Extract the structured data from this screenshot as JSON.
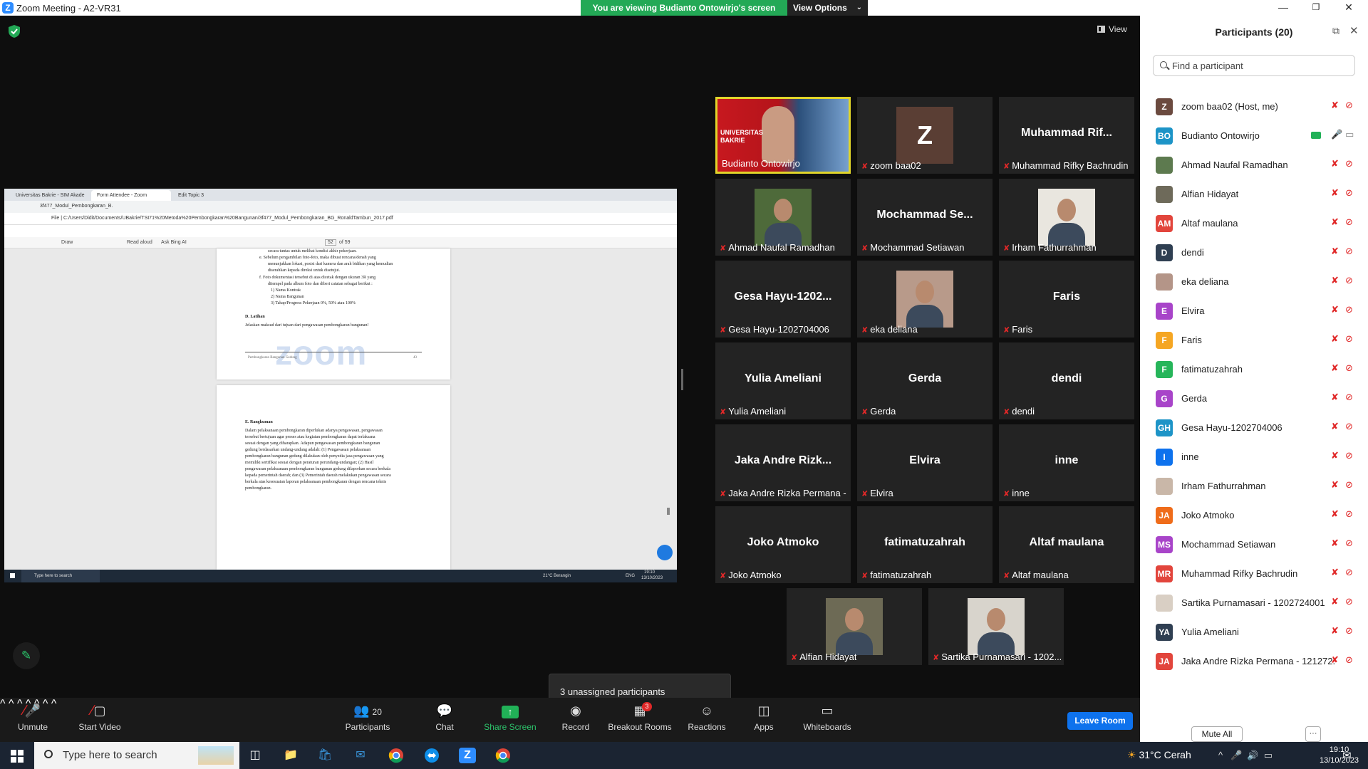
{
  "window": {
    "title": "Zoom Meeting - A2-VR31"
  },
  "banner": {
    "viewing": "You are viewing Budianto Ontowirjo's screen",
    "view_options": "View Options"
  },
  "main": {
    "view_label": "View"
  },
  "shared_screen": {
    "tabs": [
      "Universitas Bakrie - SIM Akade",
      "Form Attendee - Zoom",
      "Edit Topic 3"
    ],
    "file_tab": "3f477_Modul_Pembongkaran_B.",
    "address": "File | C:/Users/Didit/Documents/UBakrie/TSI71%20Metoda%20Pembongkaran%20Bangunan/3f477_Modul_Pembongkaran_BG_RonaldTambun_2017.pdf",
    "pdf_tools": [
      "Draw",
      "Read aloud",
      "Ask Bing AI"
    ],
    "page_num": "52",
    "page_total": "of 59",
    "page1_lines": [
      "secara tuntas untuk melihat kondisi akhir pekerjaan.",
      "e.   Sebelum pengambilan foto-foto, maka dibuat rencana/denah yang",
      "menunjukkan lokasi, posisi dari kamera dan arah bidikan yang kemudian",
      "diserahkan kepada direksi untuk disetujui.",
      "f.   Foto dokumentasi tersebut di atas dicetak dengan ukuran 3R yang",
      "ditempel pada album foto dan diberi catatan sebagai berikut :",
      "1)   Nama Kontrak",
      "2)   Nama Bangunan",
      "3)   Tahap/Progress Pekerjaan 0%, 50% atau 100%"
    ],
    "latihan_title": "D.   Latihan",
    "latihan_text": "Jelaskan maksud dari tujuan dari pengawasan pembongkaran bangunan!",
    "watermark": "zoom",
    "footer_left": "Pembongkaran Bangunan Gedung",
    "footer_page": "43",
    "rangkuman_title": "E.     Rangkuman",
    "rangkuman_lines": [
      "Dalam pelaksanaan pembongkaran diperlukan adanya pengawasan, pengawasan",
      "tersebut bertujuan agar proses atau kegiatan pembongkaran dapat terlaksana",
      "sesuai dengan yang diharapkan. Adapun pengawasan pembongkaran bangunan",
      "gedung berdasarkan undang-undang adalah: (1) Pengawasan pelaksanaan",
      "pembongkaran bangunan gedung dilakukan oleh penyedia jasa pengawasan yang",
      "memiliki sertifikat sesuai dengan peraturan perundang-undangan; (2) Hasil",
      "pengawasan pelaksanaan pembongkaran bangunan gedung dilaporkan secara berkala",
      "kepada pemerintah daerah; dan (3) Pemerintah daerah melakukan pengawasan secara",
      "berkala atas kesesuaian laporan pelaksanaan pembongkaran dengan rencana teknis",
      "pembongkaran."
    ],
    "taskbar": {
      "search": "Type here to search",
      "weather": "21°C Berangin",
      "lang": "ENG",
      "time": "19:10",
      "date": "13/10/2023"
    }
  },
  "tiles": [
    {
      "label": "Budianto Ontowirjo",
      "center": "",
      "type": "video"
    },
    {
      "label": "zoom baa02",
      "center": "",
      "type": "avatar-z"
    },
    {
      "label": "Muhammad Rifky Bachrudin",
      "center": "Muhammad  Rif..."
    },
    {
      "label": "Ahmad Naufal Ramadhan",
      "center": "",
      "type": "photo"
    },
    {
      "label": "Mochammad Setiawan",
      "center": "Mochammad  Se..."
    },
    {
      "label": "Irham Fathurrahman",
      "center": "",
      "type": "photo"
    },
    {
      "label": "Gesa Hayu-1202704006",
      "center": "Gesa  Hayu-1202..."
    },
    {
      "label": "eka deliana",
      "center": "",
      "type": "photo"
    },
    {
      "label": "Faris",
      "center": "Faris"
    },
    {
      "label": "Yulia Ameliani",
      "center": "Yulia Ameliani"
    },
    {
      "label": "Gerda",
      "center": "Gerda"
    },
    {
      "label": "dendi",
      "center": "dendi"
    },
    {
      "label": "Jaka Andre Rizka Permana - 1...",
      "center": "Jaka  Andre  Rizk..."
    },
    {
      "label": "Elvira",
      "center": "Elvira"
    },
    {
      "label": "inne",
      "center": "inne"
    },
    {
      "label": "Joko Atmoko",
      "center": "Joko Atmoko"
    },
    {
      "label": "fatimatuzahrah",
      "center": "fatimatuzahrah"
    },
    {
      "label": "Altaf maulana",
      "center": "Altaf maulana"
    },
    {
      "label": "Alfian Hidayat",
      "center": "",
      "type": "photo"
    },
    {
      "label": "Sartika Purnamasari - 1202...",
      "center": "",
      "type": "photo"
    }
  ],
  "video_overlay": {
    "line1": "UNIVERSITAS",
    "line2": "BAKRIE"
  },
  "unassigned": "3 unassigned participants",
  "toolbar": {
    "unmute": "Unmute",
    "start_video": "Start Video",
    "participants": "Participants",
    "participants_count": "20",
    "chat": "Chat",
    "share_screen": "Share Screen",
    "record": "Record",
    "breakout_rooms": "Breakout Rooms",
    "breakout_badge": "3",
    "reactions": "Reactions",
    "apps": "Apps",
    "whiteboards": "Whiteboards",
    "leave_room": "Leave Room"
  },
  "panel": {
    "title": "Participants (20)",
    "search_placeholder": "Find a participant",
    "mute_all": "Mute All",
    "more": "···",
    "participants": [
      {
        "initials": "Z",
        "color": "#6b4a3f",
        "name": "zoom baa02 (Host, me)"
      },
      {
        "initials": "BO",
        "color": "#1d94c7",
        "name": "Budianto Ontowirjo",
        "sharing": true
      },
      {
        "initials": "",
        "color": "#5d7a4f",
        "name": "Ahmad Naufal Ramadhan"
      },
      {
        "initials": "",
        "color": "#6e6a5a",
        "name": "Alfian Hidayat"
      },
      {
        "initials": "AM",
        "color": "#e2453c",
        "name": "Altaf maulana"
      },
      {
        "initials": "D",
        "color": "#2f3f52",
        "name": "dendi"
      },
      {
        "initials": "",
        "color": "#b49588",
        "name": "eka deliana"
      },
      {
        "initials": "E",
        "color": "#a844c9",
        "name": "Elvira"
      },
      {
        "initials": "F",
        "color": "#f5a623",
        "name": "Faris"
      },
      {
        "initials": "F",
        "color": "#26b55a",
        "name": "fatimatuzahrah"
      },
      {
        "initials": "G",
        "color": "#a844c9",
        "name": "Gerda"
      },
      {
        "initials": "GH",
        "color": "#1d94c7",
        "name": "Gesa Hayu-1202704006"
      },
      {
        "initials": "I",
        "color": "#0e72ed",
        "name": "inne"
      },
      {
        "initials": "",
        "color": "#c9b7a8",
        "name": "Irham Fathurrahman"
      },
      {
        "initials": "JA",
        "color": "#ef6c1a",
        "name": "Joko Atmoko"
      },
      {
        "initials": "MS",
        "color": "#a844c9",
        "name": "Mochammad Setiawan"
      },
      {
        "initials": "MR",
        "color": "#e2453c",
        "name": "Muhammad Rifky Bachrudin"
      },
      {
        "initials": "",
        "color": "#d9cfc4",
        "name": "Sartika Purnamasari - 1202724001"
      },
      {
        "initials": "YA",
        "color": "#2f3f52",
        "name": "Yulia Ameliani"
      },
      {
        "initials": "JA",
        "color": "#e2453c",
        "name": "Jaka Andre Rizka Permana - 121272..."
      }
    ]
  },
  "taskbar": {
    "search": "Type here to search",
    "weather": "31°C  Cerah",
    "time": "19:10",
    "date": "13/10/2023"
  }
}
